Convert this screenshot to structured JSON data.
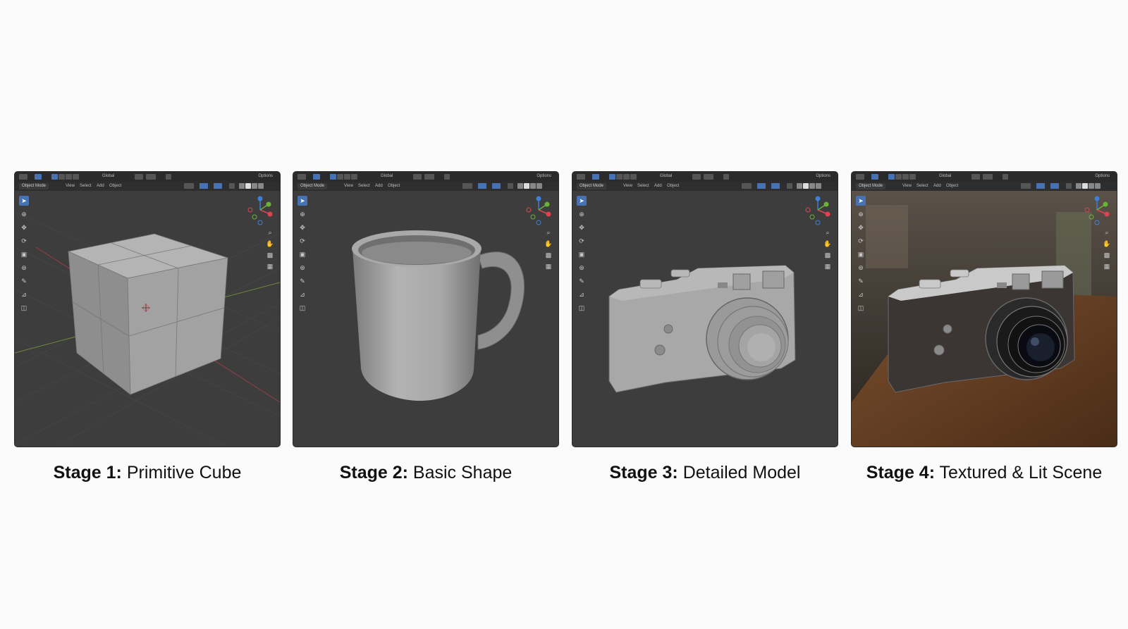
{
  "panels": [
    {
      "header": {
        "mode": "Object Mode",
        "menus": [
          "View",
          "Select",
          "Add",
          "Object"
        ],
        "orientation": "Global",
        "options": "Options"
      },
      "caption": {
        "stage": "Stage 1:",
        "title": "Primitive Cube"
      },
      "subject": "cube"
    },
    {
      "header": {
        "mode": "Object Mode",
        "menus": [
          "View",
          "Select",
          "Add",
          "Object"
        ],
        "orientation": "Global",
        "options": "Options"
      },
      "caption": {
        "stage": "Stage 2:",
        "title": "Basic Shape"
      },
      "subject": "mug"
    },
    {
      "header": {
        "mode": "Object Mode",
        "menus": [
          "View",
          "Select",
          "Add",
          "Object"
        ],
        "orientation": "Global",
        "options": "Options"
      },
      "caption": {
        "stage": "Stage 3:",
        "title": "Detailed Model"
      },
      "subject": "camera-clay"
    },
    {
      "header": {
        "mode": "Object Mode",
        "menus": [
          "View",
          "Select",
          "Add",
          "Object"
        ],
        "orientation": "Global",
        "options": "Options"
      },
      "caption": {
        "stage": "Stage 4:",
        "title": "Textured & Lit Scene"
      },
      "subject": "camera-rendered"
    }
  ],
  "toolbar_icons": [
    "select-box-icon",
    "cursor-icon",
    "move-icon",
    "rotate-icon",
    "scale-icon",
    "transform-icon",
    "annotate-icon",
    "measure-icon",
    "add-cube-icon"
  ],
  "nav_icons": [
    "zoom-icon",
    "pan-hand-icon",
    "camera-view-icon",
    "grid-ortho-icon"
  ],
  "colors": {
    "viewport": "#3d3d3d",
    "header": "#2b2b2b",
    "active_tool": "#4772b3",
    "gizmo_x": "#e0434f",
    "gizmo_y": "#6bb23a",
    "gizmo_z": "#3f7fd6"
  }
}
